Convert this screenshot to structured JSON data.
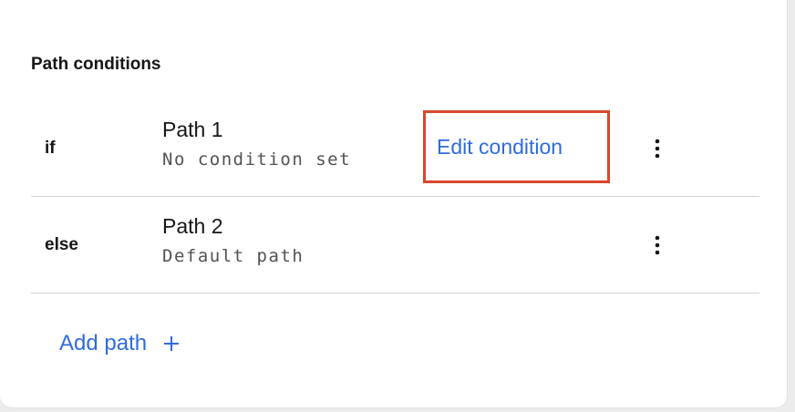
{
  "panel": {
    "section_title": "Path conditions"
  },
  "paths": [
    {
      "keyword": "if",
      "title": "Path 1",
      "subtitle": "No condition set",
      "action_label": "Edit condition",
      "menu_icon": "overflow-menu-vertical-icon"
    },
    {
      "keyword": "else",
      "title": "Path 2",
      "subtitle": "Default path",
      "menu_icon": "overflow-menu-vertical-icon"
    }
  ],
  "add_path": {
    "label": "Add path",
    "icon": "plus-icon"
  },
  "colors": {
    "link": "#2f6bde",
    "highlight_box": "#d9472b",
    "text_primary": "#161616",
    "text_secondary": "#525252",
    "divider": "#d4d4d4"
  }
}
